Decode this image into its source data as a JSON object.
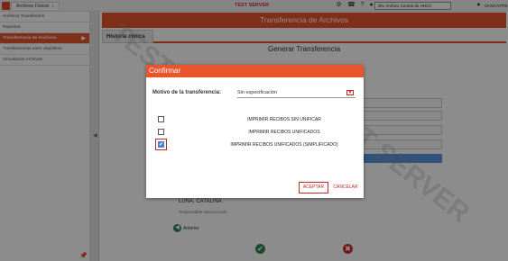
{
  "topbar": {
    "tab_label": "Archivos Físicos",
    "tab_close": "x",
    "server_label": "TEST SERVER",
    "division_select": "Div. Archivo Central de HHCC",
    "user_label": "IJANCATTRI"
  },
  "sidebar": {
    "items": [
      {
        "label": "Archivos Transferidos"
      },
      {
        "label": "Reportes"
      },
      {
        "label": "Transferencia de Archivos"
      },
      {
        "label": "Transferencias entre depósitos"
      },
      {
        "label": "Vinculación Archivos"
      }
    ]
  },
  "main": {
    "header_title": "Transferencia de Archivos",
    "tab_label": "Historia clínica",
    "section_title": "Generar Transferencia",
    "patient_name": "LUNA, CATALINA",
    "responsable_label": "Responsable seleccionado",
    "anterior_label": "Anterior",
    "watermark": "TEST SERVER"
  },
  "modal": {
    "title": "Confirmar",
    "motivo_label": "Motivo de la transferencia:",
    "motivo_value": "Sin especificación",
    "options": [
      {
        "label": "IMPRIMIR RECIBOS SIN UNIFICAR",
        "checked": false
      },
      {
        "label": "IMPRIMIR RECIBOS UNIFICADOS",
        "checked": false
      },
      {
        "label": "IMPRIMIR RECIBOS UNIFICADOS (SIMPLIFICADO)",
        "checked": true
      }
    ],
    "accept_label": "ACEPTAR",
    "cancel_label": "CANCELAR"
  },
  "colors": {
    "accent": "#e8542c",
    "danger": "#c62828",
    "checkbox": "#4a7fd8"
  }
}
